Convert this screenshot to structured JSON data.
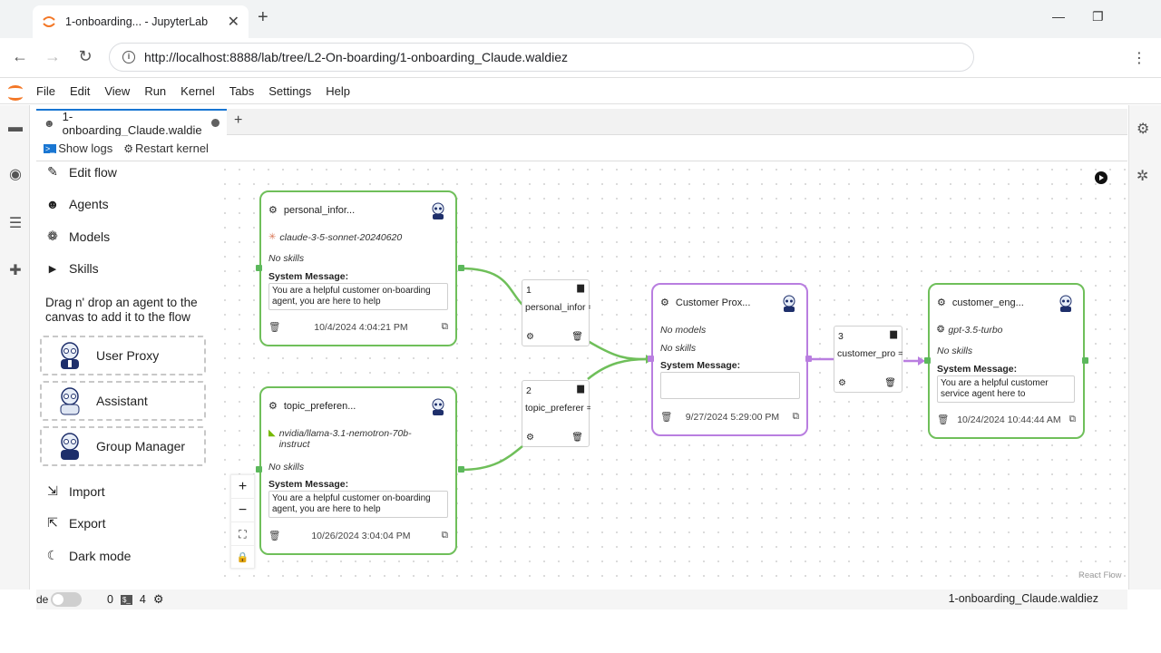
{
  "browser": {
    "tab_title": "1-onboarding... - JupyterLab",
    "url": "http://localhost:8888/lab/tree/L2-On-boarding/1-onboarding_Claude.waldiez"
  },
  "menu": [
    "File",
    "Edit",
    "View",
    "Run",
    "Kernel",
    "Tabs",
    "Settings",
    "Help"
  ],
  "doc_tab": {
    "label": "1-onboarding_Claude.waldie"
  },
  "panel_bar": {
    "show_logs": "Show logs",
    "restart_kernel": "Restart kernel"
  },
  "sidebar": {
    "edit_flow": "Edit flow",
    "agents": "Agents",
    "models": "Models",
    "skills": "Skills",
    "hint": "Drag n' drop an agent to the canvas to add it to the flow",
    "drag_items": [
      "User Proxy",
      "Assistant",
      "Group Manager"
    ],
    "import": "Import",
    "export": "Export",
    "dark_mode": "Dark mode"
  },
  "nodes": {
    "personal": {
      "name": "personal_infor...",
      "model": "claude-3-5-sonnet-20240620",
      "skills": "No skills",
      "sys_label": "System Message:",
      "sys_text": "You are a helpful customer on-boarding agent, you are here to help",
      "date": "10/4/2024 4:04:21 PM"
    },
    "topic": {
      "name": "topic_preferen...",
      "model": "nvidia/llama-3.1-nemotron-70b-instruct",
      "skills": "No skills",
      "sys_label": "System Message:",
      "sys_text": "You are a helpful customer on-boarding agent, you are here to help",
      "date": "10/26/2024 3:04:04 PM"
    },
    "proxy": {
      "name": "Customer Prox...",
      "models": "No models",
      "skills": "No skills",
      "sys_label": "System Message:",
      "sys_text": "",
      "date": "9/27/2024 5:29:00 PM"
    },
    "engage": {
      "name": "customer_eng...",
      "model": "gpt-3.5-turbo",
      "skills": "No skills",
      "sys_label": "System Message:",
      "sys_text": "You are a helpful customer service agent here to",
      "date": "10/24/2024 10:44:44 AM"
    }
  },
  "chats": [
    {
      "num": "1",
      "label": "personal_infor =>..."
    },
    {
      "num": "2",
      "label": "topic_preferer =>..."
    },
    {
      "num": "3",
      "label": "customer_pro =>..."
    }
  ],
  "canvas": {
    "react_flow": "React Flow"
  },
  "status": {
    "mode": "de",
    "count_a": "0",
    "count_b": "4",
    "file": "1-onboarding_Claude.waldiez"
  },
  "colors": {
    "agent_border": "#6fbf5a",
    "user_border": "#b97ee0",
    "accent": "#1976d2"
  }
}
